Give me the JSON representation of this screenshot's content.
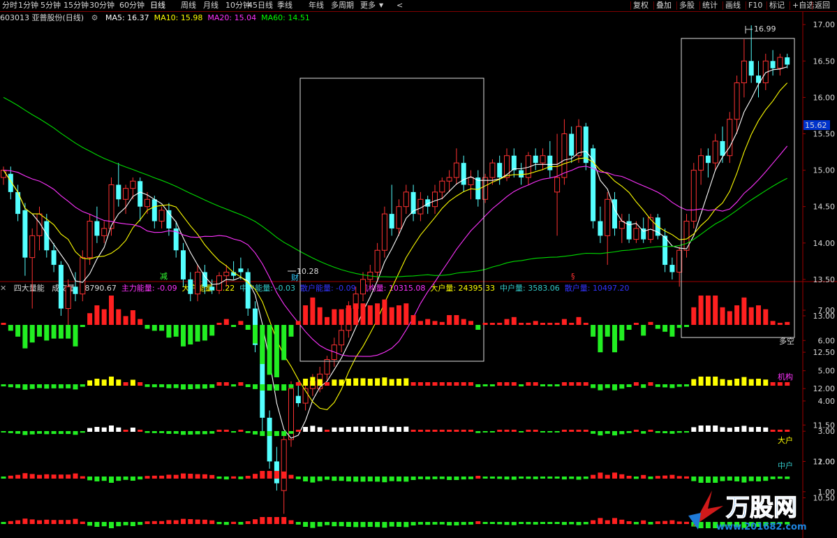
{
  "toolbar": {
    "left": [
      "分时",
      "1分钟",
      "5分钟",
      "15分钟",
      "30分钟",
      "60分钟",
      "日线",
      "周线",
      "月线",
      "10分钟",
      "45日线",
      "季线",
      "年线",
      "多周期",
      "更多"
    ],
    "active": "日线",
    "more_arrow": "▼",
    "back_arrow": "<",
    "right": [
      "复权",
      "叠加",
      "多股",
      "统计",
      "画线",
      "F10",
      "标记",
      "+自选",
      "返回"
    ]
  },
  "stock": {
    "code_name": "603013 亚普股份(日线)",
    "ma": [
      {
        "label": "MA5: 16.37",
        "color": "#ffffff"
      },
      {
        "label": "MA10: 15.98",
        "color": "#ffff00"
      },
      {
        "label": "MA20: 15.04",
        "color": "#ff33ff"
      },
      {
        "label": "MA60: 14.51",
        "color": "#00ff00"
      }
    ]
  },
  "indicator": {
    "name": "四大量能",
    "items": [
      {
        "label": "成交量: 48790.67",
        "color": "#dddddd"
      },
      {
        "label": "主力能量: -0.09",
        "color": "#ff33ff"
      },
      {
        "label": "大户能量: 0.22",
        "color": "#ffff00"
      },
      {
        "label": "中户能量: -0.03",
        "color": "#33cccc"
      },
      {
        "label": "散户能量: -0.09",
        "color": "#3333ff"
      },
      {
        "label": "机构量: 10315.08",
        "color": "#ff33ff"
      },
      {
        "label": "大户量: 24395.33",
        "color": "#ffff00"
      },
      {
        "label": "中户量: 3583.06",
        "color": "#33cccc"
      },
      {
        "label": "散户量: 10497.20",
        "color": "#3333ff"
      }
    ]
  },
  "axis": {
    "price_ticks": [
      "17.00",
      "16.50",
      "16.00",
      "15.50",
      "15.00",
      "14.50",
      "14.00",
      "13.50",
      "13.00",
      "12.50",
      "12.00",
      "11.50",
      "11.00",
      "10.50"
    ],
    "current_price": "15.62",
    "ind_ticks": [
      "7.00",
      "6.00",
      "5.00",
      "4.00",
      "3.00",
      "2.00",
      "1.00"
    ]
  },
  "annotations": {
    "high": "16.99",
    "low": "10.28",
    "sig_jian": "减",
    "sig_cai": "财",
    "sig_s": "§"
  },
  "row_labels": [
    "多空",
    "机构",
    "大户",
    "中户"
  ],
  "watermark": {
    "brand": "万股网",
    "site": "www.201682.com"
  },
  "colors": {
    "up": "#ff3232",
    "down": "#54ffff",
    "ma5": "#ffffff",
    "ma10": "#ffff00",
    "ma20": "#ff33ff",
    "ma60": "#00dd00"
  },
  "chart_data": {
    "type": "candlestick",
    "y_range": [
      10.2,
      17.1
    ],
    "ohlc": [
      [
        14.9,
        15.05,
        14.8,
        15.0
      ],
      [
        14.95,
        15.05,
        14.6,
        14.7
      ],
      [
        14.7,
        14.8,
        14.3,
        14.4
      ],
      [
        14.45,
        14.55,
        13.55,
        13.8
      ],
      [
        13.8,
        14.2,
        13.1,
        14.1
      ],
      [
        14.1,
        14.5,
        13.9,
        14.4
      ],
      [
        14.3,
        14.4,
        13.8,
        13.9
      ],
      [
        13.9,
        14.0,
        13.6,
        13.7
      ],
      [
        13.7,
        13.75,
        13.0,
        13.1
      ],
      [
        13.1,
        13.5,
        12.85,
        13.4
      ],
      [
        13.4,
        13.6,
        13.2,
        13.3
      ],
      [
        13.3,
        13.9,
        13.2,
        13.8
      ],
      [
        13.8,
        14.4,
        13.7,
        14.3
      ],
      [
        14.3,
        14.5,
        14.0,
        14.1
      ],
      [
        14.1,
        14.3,
        14.0,
        14.2
      ],
      [
        14.2,
        14.9,
        14.1,
        14.8
      ],
      [
        14.8,
        15.1,
        14.5,
        14.6
      ],
      [
        14.6,
        14.8,
        14.4,
        14.75
      ],
      [
        14.75,
        14.9,
        14.6,
        14.85
      ],
      [
        14.85,
        14.9,
        14.3,
        14.5
      ],
      [
        14.5,
        14.7,
        14.4,
        14.6
      ],
      [
        14.6,
        14.65,
        14.2,
        14.3
      ],
      [
        14.3,
        14.5,
        14.2,
        14.45
      ],
      [
        14.45,
        14.55,
        14.1,
        14.2
      ],
      [
        14.2,
        14.3,
        13.8,
        13.9
      ],
      [
        13.9,
        14.0,
        13.4,
        13.5
      ],
      [
        13.5,
        13.6,
        13.2,
        13.3
      ],
      [
        13.3,
        13.7,
        13.2,
        13.6
      ],
      [
        13.6,
        13.7,
        13.3,
        13.4
      ],
      [
        13.4,
        13.5,
        13.3,
        13.35
      ],
      [
        13.35,
        13.6,
        13.3,
        13.55
      ],
      [
        13.55,
        13.7,
        13.4,
        13.6
      ],
      [
        13.6,
        13.75,
        13.5,
        13.55
      ],
      [
        13.65,
        13.8,
        13.5,
        13.6
      ],
      [
        13.6,
        13.65,
        13.0,
        13.1
      ],
      [
        13.1,
        13.2,
        12.5,
        12.6
      ],
      [
        12.6,
        12.7,
        11.4,
        11.6
      ],
      [
        11.6,
        11.7,
        10.9,
        11.0
      ],
      [
        11.0,
        11.2,
        10.6,
        10.7
      ],
      [
        10.6,
        11.4,
        10.28,
        11.3
      ],
      [
        11.3,
        12.1,
        11.2,
        12.0
      ],
      [
        11.9,
        12.1,
        11.75,
        11.8
      ],
      [
        11.8,
        12.05,
        11.7,
        12.0
      ],
      [
        12.0,
        12.2,
        11.9,
        12.1
      ],
      [
        12.0,
        12.3,
        11.95,
        12.2
      ],
      [
        12.2,
        12.45,
        12.1,
        12.4
      ],
      [
        12.4,
        12.7,
        12.3,
        12.6
      ],
      [
        12.6,
        12.9,
        12.5,
        12.8
      ],
      [
        12.8,
        13.2,
        12.7,
        13.1
      ],
      [
        13.1,
        13.4,
        13.0,
        13.3
      ],
      [
        13.3,
        13.6,
        13.2,
        13.5
      ],
      [
        13.5,
        13.7,
        13.4,
        13.6
      ],
      [
        13.6,
        14.0,
        13.5,
        13.9
      ],
      [
        13.9,
        14.5,
        13.8,
        14.4
      ],
      [
        14.4,
        14.8,
        14.1,
        14.2
      ],
      [
        14.2,
        14.6,
        14.1,
        14.5
      ],
      [
        14.5,
        14.8,
        14.4,
        14.7
      ],
      [
        14.7,
        14.8,
        14.3,
        14.4
      ],
      [
        14.4,
        14.7,
        14.3,
        14.6
      ],
      [
        14.6,
        14.65,
        14.4,
        14.5
      ],
      [
        14.5,
        14.8,
        14.4,
        14.7
      ],
      [
        14.7,
        14.9,
        14.6,
        14.85
      ],
      [
        14.85,
        15.0,
        14.7,
        14.9
      ],
      [
        14.9,
        15.3,
        14.8,
        15.1
      ],
      [
        15.1,
        15.2,
        14.7,
        14.8
      ],
      [
        14.8,
        15.0,
        14.6,
        14.9
      ],
      [
        14.9,
        15.0,
        14.5,
        14.6
      ],
      [
        14.6,
        14.95,
        14.55,
        14.9
      ],
      [
        14.9,
        15.15,
        14.8,
        15.1
      ],
      [
        15.1,
        15.2,
        14.8,
        14.9
      ],
      [
        14.9,
        15.3,
        14.85,
        15.2
      ],
      [
        15.2,
        15.3,
        14.9,
        15.0
      ],
      [
        15.0,
        15.1,
        14.8,
        14.9
      ],
      [
        14.9,
        15.25,
        14.8,
        15.2
      ],
      [
        15.2,
        15.3,
        15.0,
        15.1
      ],
      [
        15.1,
        15.3,
        15.0,
        15.2
      ],
      [
        15.2,
        15.4,
        14.9,
        15.0
      ],
      [
        14.7,
        15.5,
        14.1,
        14.9
      ],
      [
        14.9,
        15.7,
        14.8,
        15.5
      ],
      [
        15.5,
        15.6,
        15.1,
        15.2
      ],
      [
        15.2,
        15.7,
        15.1,
        15.6
      ],
      [
        15.6,
        15.65,
        15.0,
        15.1
      ],
      [
        15.3,
        15.35,
        14.2,
        14.3
      ],
      [
        14.3,
        14.5,
        14.0,
        14.1
      ],
      [
        14.1,
        14.7,
        13.7,
        14.6
      ],
      [
        14.6,
        14.7,
        14.1,
        14.2
      ],
      [
        14.2,
        14.4,
        14.0,
        14.3
      ],
      [
        14.3,
        14.4,
        14.0,
        14.05
      ],
      [
        14.05,
        14.3,
        14.0,
        14.2
      ],
      [
        14.2,
        14.35,
        14.0,
        14.05
      ],
      [
        14.05,
        14.4,
        14.0,
        14.35
      ],
      [
        14.35,
        14.4,
        14.05,
        14.1
      ],
      [
        14.1,
        14.2,
        13.6,
        13.7
      ],
      [
        13.7,
        13.8,
        13.5,
        13.6
      ],
      [
        13.6,
        13.95,
        13.4,
        13.9
      ],
      [
        13.9,
        14.4,
        13.8,
        14.3
      ],
      [
        14.3,
        15.1,
        14.2,
        15.0
      ],
      [
        15.0,
        15.3,
        14.8,
        15.2
      ],
      [
        15.2,
        15.3,
        14.9,
        15.1
      ],
      [
        15.1,
        15.5,
        15.0,
        15.4
      ],
      [
        15.4,
        15.6,
        15.1,
        15.2
      ],
      [
        15.2,
        15.8,
        15.1,
        15.7
      ],
      [
        15.7,
        16.3,
        15.5,
        16.2
      ],
      [
        16.2,
        16.8,
        16.0,
        16.5
      ],
      [
        16.5,
        16.99,
        16.2,
        16.3
      ],
      [
        16.3,
        16.5,
        16.0,
        16.2
      ],
      [
        16.2,
        16.6,
        16.1,
        16.5
      ],
      [
        16.5,
        16.65,
        16.3,
        16.4
      ],
      [
        16.4,
        16.6,
        16.3,
        16.55
      ],
      [
        16.55,
        16.6,
        16.4,
        16.45
      ]
    ]
  }
}
